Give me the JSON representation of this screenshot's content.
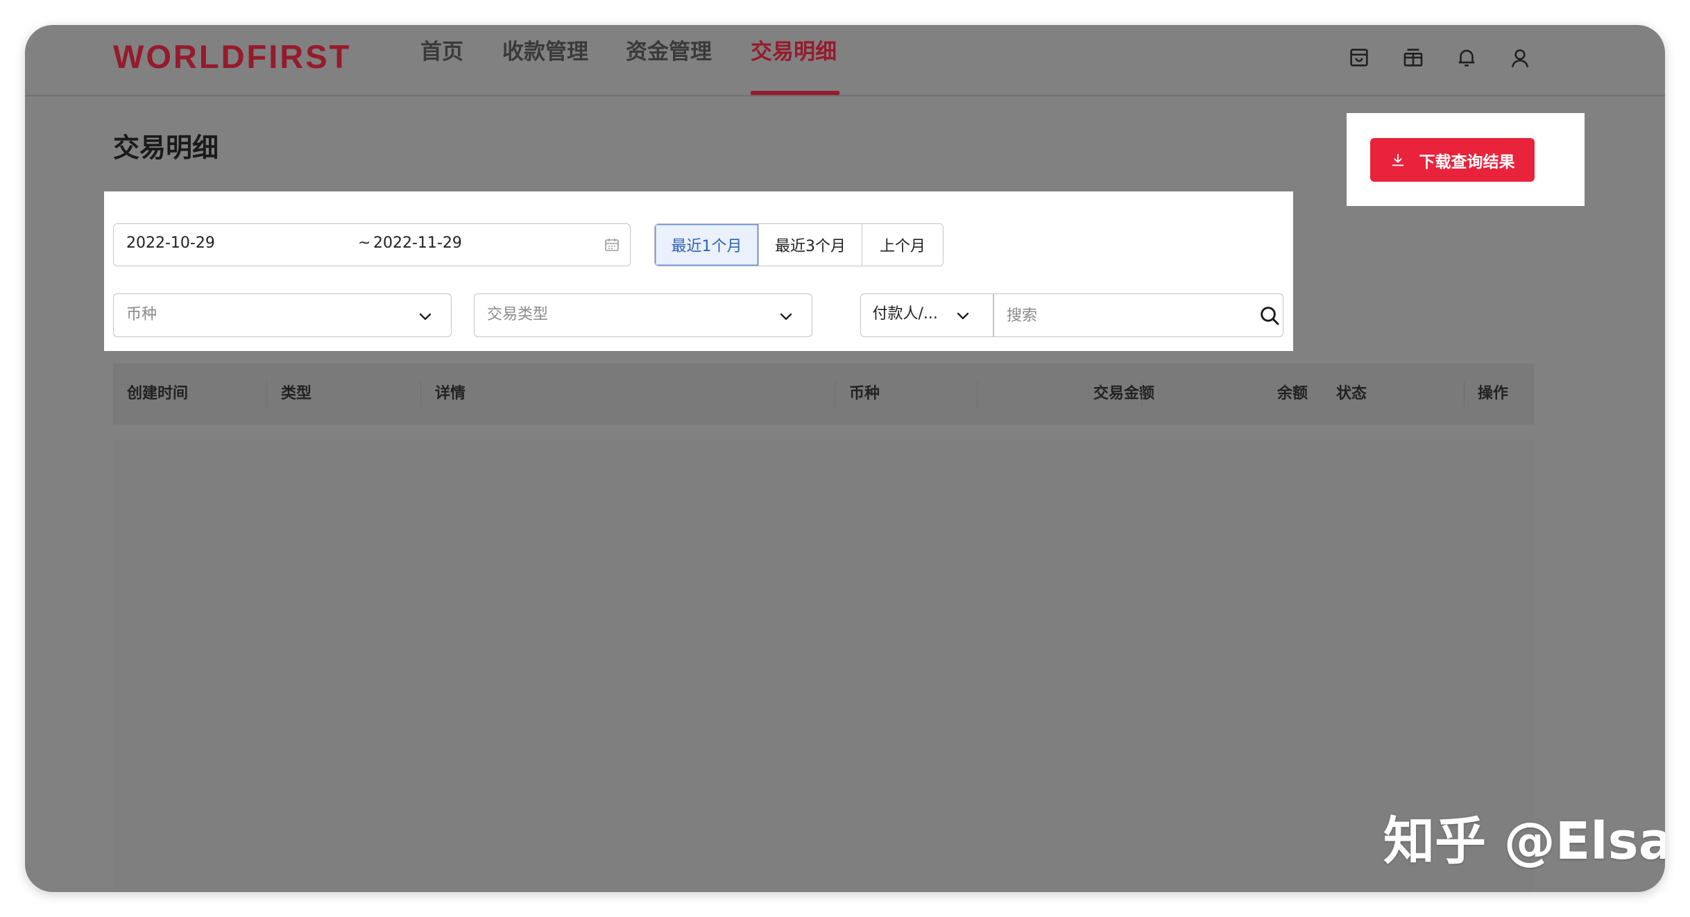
{
  "header": {
    "logo": "WORLDFIRST",
    "nav": [
      {
        "label": "首页"
      },
      {
        "label": "收款管理"
      },
      {
        "label": "资金管理"
      },
      {
        "label": "交易明细",
        "active": true
      }
    ],
    "icons": [
      "wallet-icon",
      "gift-icon",
      "bell-icon",
      "user-icon"
    ]
  },
  "page": {
    "title": "交易明细"
  },
  "download": {
    "label": "下载查询结果",
    "icon": "download-icon"
  },
  "filters": {
    "date_start": "2022-10-29",
    "date_separator": "~",
    "date_end": "2022-11-29",
    "quick_ranges": [
      {
        "label": "最近1个月",
        "active": true
      },
      {
        "label": "最近3个月"
      },
      {
        "label": "上个月"
      }
    ],
    "currency_placeholder": "币种",
    "type_placeholder": "交易类型",
    "search_field_value": "付款人/...",
    "search_placeholder": "搜索"
  },
  "table": {
    "columns": [
      "创建时间",
      "类型",
      "详情",
      "币种",
      "交易金额",
      "余额",
      "状态",
      "操作"
    ]
  },
  "watermark": "知乎 @Elsa",
  "colors": {
    "brand": "#951b2c",
    "primary_button": "#e8233b",
    "overlay": "#818181",
    "active_segment_text": "#2f5fb4"
  }
}
